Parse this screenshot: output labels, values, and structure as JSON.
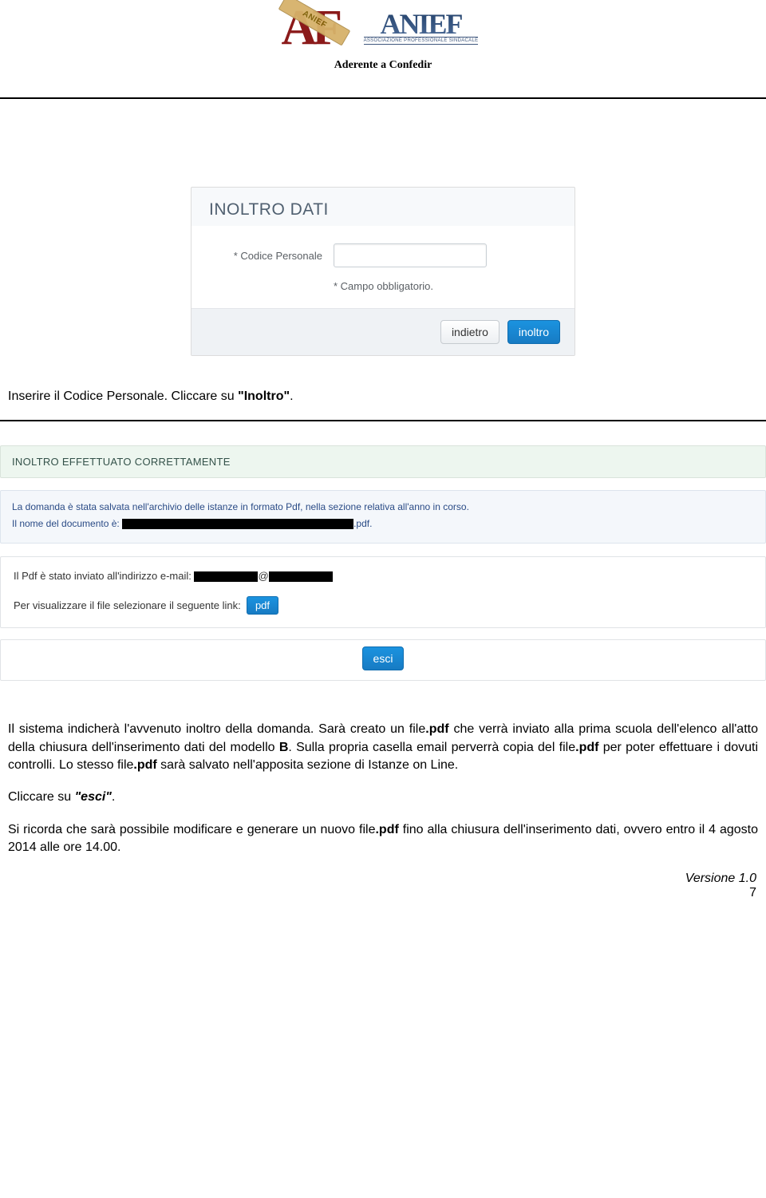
{
  "header": {
    "subheading": "Aderente a Confedir",
    "anief_word": "ANIEF",
    "anief_sub": "ASSOCIAZIONE PROFESSIONALE SINDACALE",
    "af_letters": "AF",
    "af_sash": "ANIEF"
  },
  "panel1": {
    "title": "INOLTRO DATI",
    "label_codice": "* Codice Personale",
    "note": "* Campo obbligatorio.",
    "btn_back": "indietro",
    "btn_submit": "inoltro"
  },
  "text1": {
    "before_bold": "Inserire il Codice Personale. Cliccare su ",
    "bold": "\"Inoltro\"",
    "after": "."
  },
  "success_bar": "INOLTRO EFFETTUATO CORRETTAMENTE",
  "msg": {
    "line1": "La domanda è stata salvata nell'archivio delle istanze in formato Pdf, nella sezione relativa all'anno in corso.",
    "line2_pre": "Il nome del documento è:",
    "line2_suffix": ".pdf."
  },
  "plain": {
    "line1_pre": "Il Pdf è stato inviato all'indirizzo e-mail:",
    "at": "@",
    "line2_pre": "Per visualizzare il file selezionare il seguente link:",
    "link_label": "pdf"
  },
  "btn_exit": "esci",
  "para2": {
    "p1_a": "Il sistema indicherà l'avvenuto inoltro della domanda. Sarà creato un file",
    "p1_b": ".pdf",
    "p1_c": " che verrà inviato alla prima scuola dell'elenco all'atto della chiusura dell'inserimento dati del modello ",
    "p1_d": "B",
    "p1_e": ". Sulla propria  casella email perverrà copia del file",
    "p1_f": ".pdf",
    "p1_g": " per poter effettuare i dovuti controlli. Lo stesso file",
    "p1_h": ".pdf",
    "p1_i": " sarà salvato nell'apposita sezione di Istanze on Line.",
    "p2_a": "Cliccare su ",
    "p2_b": "\"esci\"",
    "p2_c": ".",
    "p3_a": "Si ricorda che sarà possibile modificare e generare un nuovo file",
    "p3_b": ".pdf",
    "p3_c": " fino alla chiusura dell'inserimento dati, ovvero entro il 4 agosto 2014 alle ore 14.00."
  },
  "footer": {
    "version": "Versione 1.0",
    "page": "7"
  }
}
